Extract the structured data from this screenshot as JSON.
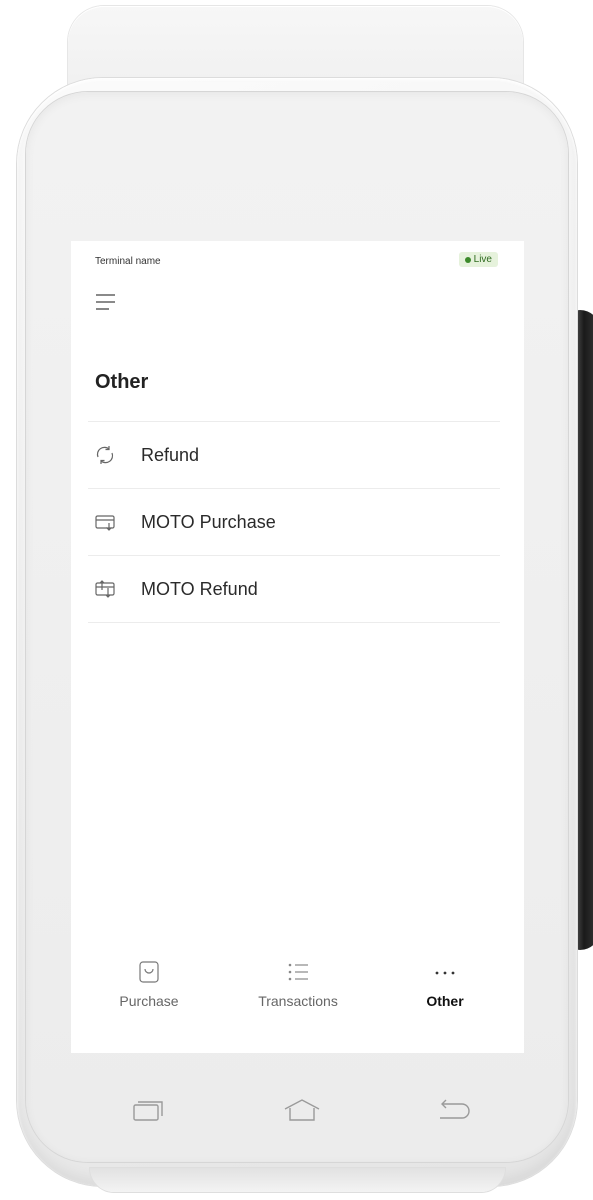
{
  "status_bar": {
    "terminal_name": "Terminal name",
    "live_label": "Live",
    "live_color": "#3c8a2a"
  },
  "header": {
    "menu_icon": "hamburger-menu-icon",
    "title": "Other"
  },
  "menu": {
    "items": [
      {
        "label": "Refund",
        "icon": "refund-cycle-icon"
      },
      {
        "label": "MOTO Purchase",
        "icon": "card-purchase-icon"
      },
      {
        "label": "MOTO Refund",
        "icon": "card-refund-icon"
      }
    ]
  },
  "bottom_nav": {
    "tabs": [
      {
        "label": "Purchase",
        "icon": "shopping-bag-icon",
        "active": false
      },
      {
        "label": "Transactions",
        "icon": "list-icon",
        "active": false
      },
      {
        "label": "Other",
        "icon": "more-dots-icon",
        "active": true
      }
    ]
  },
  "system_buttons": {
    "recent": "recent-apps-icon",
    "home": "home-icon",
    "back": "back-arrow-icon"
  },
  "colors": {
    "screen_background": "#ffffff",
    "text_primary": "#222222",
    "divider": "#ececec",
    "badge_background": "#e6f2dc"
  }
}
